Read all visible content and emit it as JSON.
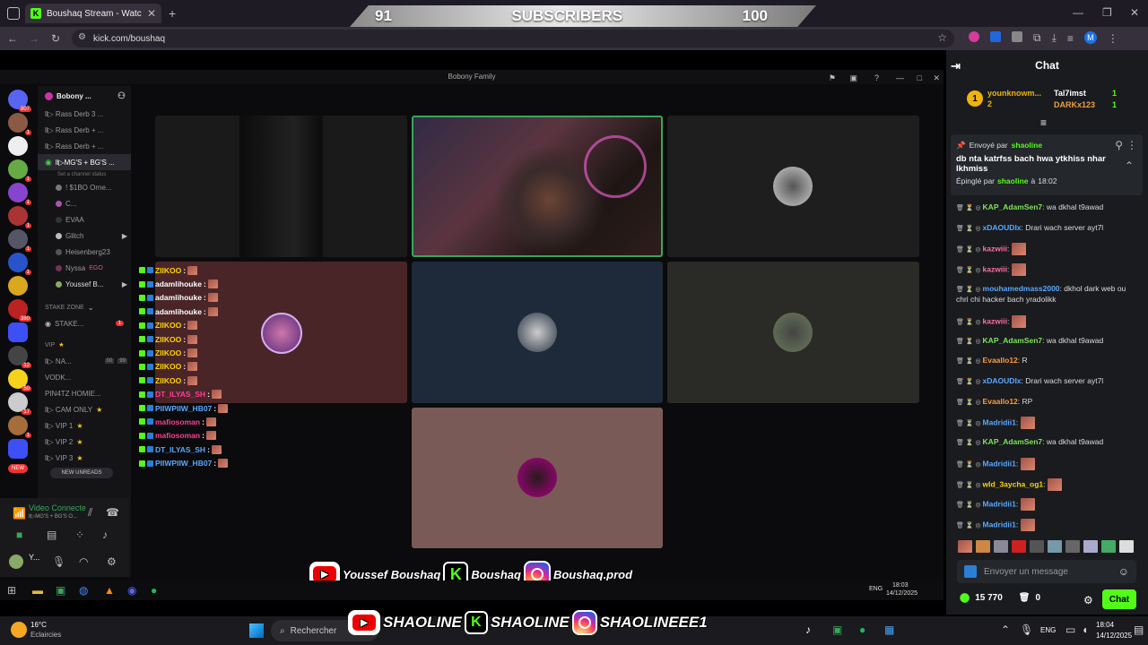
{
  "browser": {
    "tab_title": "Boushaq Stream - Watch Li",
    "url": "kick.com/boushaq",
    "profile_initial": "M"
  },
  "subscriber_goal": {
    "current": "91",
    "label": "SUBSCRIBERS",
    "target": "100"
  },
  "discord": {
    "window_title": "Bobony Family",
    "server_name": "Bobony ...",
    "server_badges": [
      "807",
      "1",
      "1",
      "1",
      "1",
      "1",
      "1",
      "380",
      "12",
      "50",
      "17",
      "1"
    ],
    "channels": [
      {
        "label": "ll▷ Rass Derb 3 ..."
      },
      {
        "label": "ll▷ Rass Derb + ..."
      },
      {
        "label": "ll▷ Rass Derb + ..."
      },
      {
        "label": "ll▷MG'S + BG'S ..."
      },
      {
        "label": "Set a channel status"
      }
    ],
    "voice_users": [
      "! $1BO Orne...",
      "C...",
      "EVAA",
      "Glitch",
      "Heisenberg23",
      "Nyssa",
      "Youssef B..."
    ],
    "ego_tag": "EGO",
    "category_stake": "STAKE ZONE",
    "stake_channel": "STAKE...",
    "category_vip": "VIP",
    "vip_channels": [
      "ll▷ NA...",
      "VODK...",
      "PIN4TZ HOMIE...",
      "ll▷ CAM ONLY",
      "ll▷ VIP 1",
      "ll▷ VIP 2",
      "ll▷ VIP 3"
    ],
    "stat_a": "00",
    "stat_b": "99",
    "new_unreads": "NEW UNREADS",
    "new_label": "NEW",
    "voice_connected": "Video Connecte",
    "voice_channel": "ll▷MG'S + BG'S O...",
    "user_short": "Y..."
  },
  "stream_chat_overlay": [
    {
      "user": "ZIIKOO",
      "color": "#ffd400"
    },
    {
      "user": "adamlihouke",
      "color": "#ffffff"
    },
    {
      "user": "adamlihouke",
      "color": "#ffffff"
    },
    {
      "user": "adamlihouke",
      "color": "#ffffff"
    },
    {
      "user": "ZIIKOO",
      "color": "#ffd400"
    },
    {
      "user": "ZIIKOO",
      "color": "#ffd400"
    },
    {
      "user": "ZIIKOO",
      "color": "#ffd400"
    },
    {
      "user": "ZIIKOO",
      "color": "#ffd400"
    },
    {
      "user": "ZIIKOO",
      "color": "#ffd400"
    },
    {
      "user": "DT_ILYAS_SH",
      "color": "#ff3f9a"
    },
    {
      "user": "PIIWPIIW_HB07",
      "color": "#5aa8ff"
    },
    {
      "user": "mafiosoman",
      "color": "#ff3f9a"
    },
    {
      "user": "mafiosoman",
      "color": "#ff3f9a"
    },
    {
      "user": "DT_ILYAS_SH",
      "color": "#5aa8ff"
    },
    {
      "user": "PIIWPIIW_HB07",
      "color": "#5aa8ff"
    }
  ],
  "kick_chat": {
    "title": "Chat",
    "leader_user": "younknowm...",
    "leader_count": "2",
    "top_users": [
      {
        "name": "Tal7imst",
        "count": "1"
      },
      {
        "name": "DARKx123",
        "count": "1"
      }
    ],
    "pinned": {
      "sent_by_label": "Envoyé par",
      "sender": "shaoline",
      "text": "db nta katrfss bach hwa ytkhiss nhar lkhmiss",
      "pinned_by_label": "Épinglé par",
      "pinner": "shaoline",
      "at_label": "à",
      "time": "18:02"
    },
    "messages": [
      {
        "user": "KAP_AdamSen7",
        "color": "#7ee35a",
        "text": "wa dkhal t9awad",
        "emote": false
      },
      {
        "user": "xDAOUDIx",
        "color": "#5aa8ff",
        "text": "Drari wach server ayt7l",
        "emote": false
      },
      {
        "user": "kazwiii",
        "color": "#ff6fa0",
        "text": "",
        "emote": true
      },
      {
        "user": "kazwiii",
        "color": "#ff6fa0",
        "text": "",
        "emote": true
      },
      {
        "user": "mouhamedmass2000",
        "color": "#5aa8ff",
        "text": "dkhol dark web ou chri chi hacker bach yradolikk",
        "emote": false
      },
      {
        "user": "kazwiii",
        "color": "#ff6fa0",
        "text": "",
        "emote": true
      },
      {
        "user": "KAP_AdamSen7",
        "color": "#7ee35a",
        "text": "wa dkhal t9awad",
        "emote": false
      },
      {
        "user": "Evaallo12",
        "color": "#ff9b3a",
        "text": "R",
        "emote": false
      },
      {
        "user": "xDAOUDIx",
        "color": "#5aa8ff",
        "text": "Drari wach server ayt7l",
        "emote": false
      },
      {
        "user": "Evaallo12",
        "color": "#ff9b3a",
        "text": "RP",
        "emote": false
      },
      {
        "user": "Madridii1",
        "color": "#5aa8ff",
        "text": "",
        "emote": true
      },
      {
        "user": "KAP_AdamSen7",
        "color": "#7ee35a",
        "text": "wa dkhal t9awad",
        "emote": false
      },
      {
        "user": "Madridii1",
        "color": "#5aa8ff",
        "text": "",
        "emote": true
      },
      {
        "user": "wld_3aycha_og1",
        "color": "#ffd400",
        "text": "",
        "emote": true
      },
      {
        "user": "Madridii1",
        "color": "#5aa8ff",
        "text": "",
        "emote": true
      },
      {
        "user": "Madridii1",
        "color": "#5aa8ff",
        "text": "",
        "emote": true
      }
    ],
    "input_placeholder": "Envoyer un message",
    "points": "15 770",
    "zero": "0",
    "chat_button": "Chat"
  },
  "socials_top": {
    "youtube": "Youssef Boushaq",
    "kick": "Boushaq",
    "instagram": "Boushaq.prod"
  },
  "socials_bottom": {
    "youtube": "SHAOLINE",
    "kick": "SHAOLINE",
    "instagram": "SHAOLINEEE1"
  },
  "inner_taskbar": {
    "lang": "ENG",
    "time": "18:03",
    "date": "14/12/2025"
  },
  "taskbar": {
    "weather_temp": "16°C",
    "weather_desc": "Eclaircies",
    "search": "Rechercher",
    "lang": "ENG",
    "time": "18:04",
    "date": "14/12/2025"
  },
  "colors": {
    "kick_green": "#53fc18",
    "discord_bg": "#0b0b0d"
  }
}
